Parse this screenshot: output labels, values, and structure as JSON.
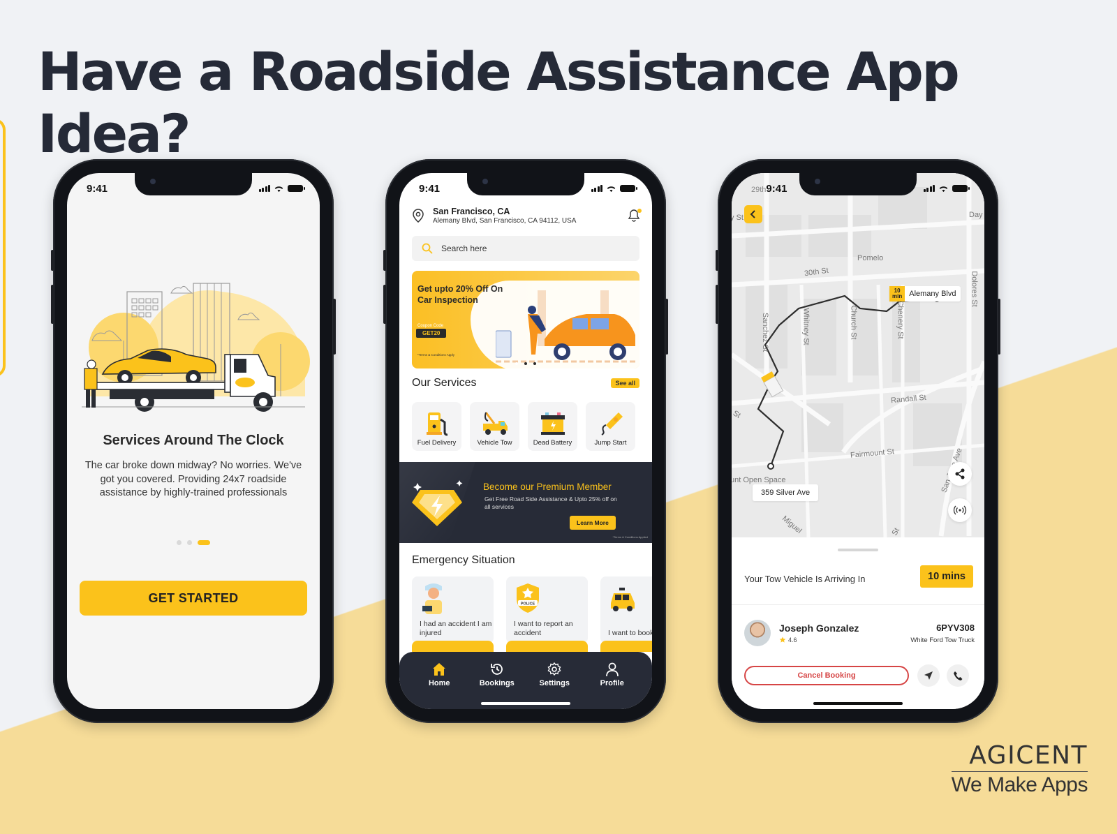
{
  "headline": "Have a Roadside Assistance App Idea?",
  "colors": {
    "brand_yellow": "#fbc21b",
    "dark_navy": "#272b37",
    "background": "#f0f2f5",
    "accent_band": "#f6dc98",
    "cancel_red": "#d64545"
  },
  "status_bar": {
    "time": "9:41"
  },
  "onboarding": {
    "title": "Services Around The Clock",
    "description": "The car broke down midway? No worries. We've got you covered. Providing 24x7 roadside assistance by highly-trained professionals",
    "pagination": {
      "total": 3,
      "active": 3
    },
    "cta_label": "GET STARTED"
  },
  "home": {
    "location": {
      "city": "San Francisco, CA",
      "address": "Alemany Blvd, San Francisco, CA 94112, USA",
      "icon": "location-pin-icon"
    },
    "notification_icon": "bell-icon",
    "search": {
      "placeholder": "Search here",
      "value": ""
    },
    "promo": {
      "title": "Get upto 20% Off On Car Inspection",
      "coupon_label": "Coupon Code",
      "coupon_code": "GET20",
      "terms": "*Terms & Conditions Apply",
      "slides": 3,
      "active_slide": 1
    },
    "services_title": "Our Services",
    "see_all_label": "See all",
    "services": [
      {
        "label": "Fuel Delivery",
        "icon": "fuel-pump-icon"
      },
      {
        "label": "Vehicle Tow",
        "icon": "tow-truck-icon"
      },
      {
        "label": "Dead Battery",
        "icon": "battery-icon"
      },
      {
        "label": "Jump Start",
        "icon": "jumper-cable-icon"
      }
    ],
    "premium": {
      "title": "Become our Premium Member",
      "subtitle": "Get Free Road Side Assistance & Upto 25% off on all services",
      "cta_label": "Learn More",
      "terms": "*Terms & Conditions Applied"
    },
    "emergency_title": "Emergency Situation",
    "emergency": [
      {
        "label": "I had an accident I am injured",
        "icon": "injured-person-icon"
      },
      {
        "label": "I want to report an accident",
        "icon": "police-badge-icon"
      },
      {
        "label": "I want to book a ride",
        "icon": "taxi-icon"
      }
    ],
    "tabs": [
      {
        "label": "Home",
        "icon": "home-icon",
        "active": true
      },
      {
        "label": "Bookings",
        "icon": "history-icon",
        "active": false
      },
      {
        "label": "Settings",
        "icon": "gear-icon",
        "active": false
      },
      {
        "label": "Profile",
        "icon": "user-icon",
        "active": false
      }
    ]
  },
  "tracking": {
    "status_prefix": "29th",
    "map_labels": {
      "street_1": "y St",
      "pomelo": "Pomelo",
      "thirtieth": "30th St",
      "sanchez": "Sanchez St",
      "whitney": "Whitney St",
      "church": "Church St",
      "chenery": "Chenery St",
      "randall": "Randall St",
      "fairmount": "Fairmount St",
      "open_space": "unt Open Space",
      "san_jose": "San Jose Ave",
      "dolores": "Dolores St",
      "day": "Day",
      "miguel": "Miguel",
      "st_left": "St",
      "st_bottom": "St"
    },
    "eta_tag": {
      "value": "10",
      "unit": "min",
      "label": "Alemany Blvd"
    },
    "destination_label": "359 Silver Ave",
    "arriving_text": "Your Tow Vehicle Is Arriving In",
    "arriving_eta": "10 mins",
    "driver": {
      "name": "Joseph Gonzalez",
      "rating": "4.6",
      "plate": "6PYV308",
      "vehicle": "White Ford Tow Truck"
    },
    "cancel_label": "Cancel Booking"
  },
  "logo": {
    "brand": "AGICENT",
    "tagline": "We Make Apps"
  }
}
